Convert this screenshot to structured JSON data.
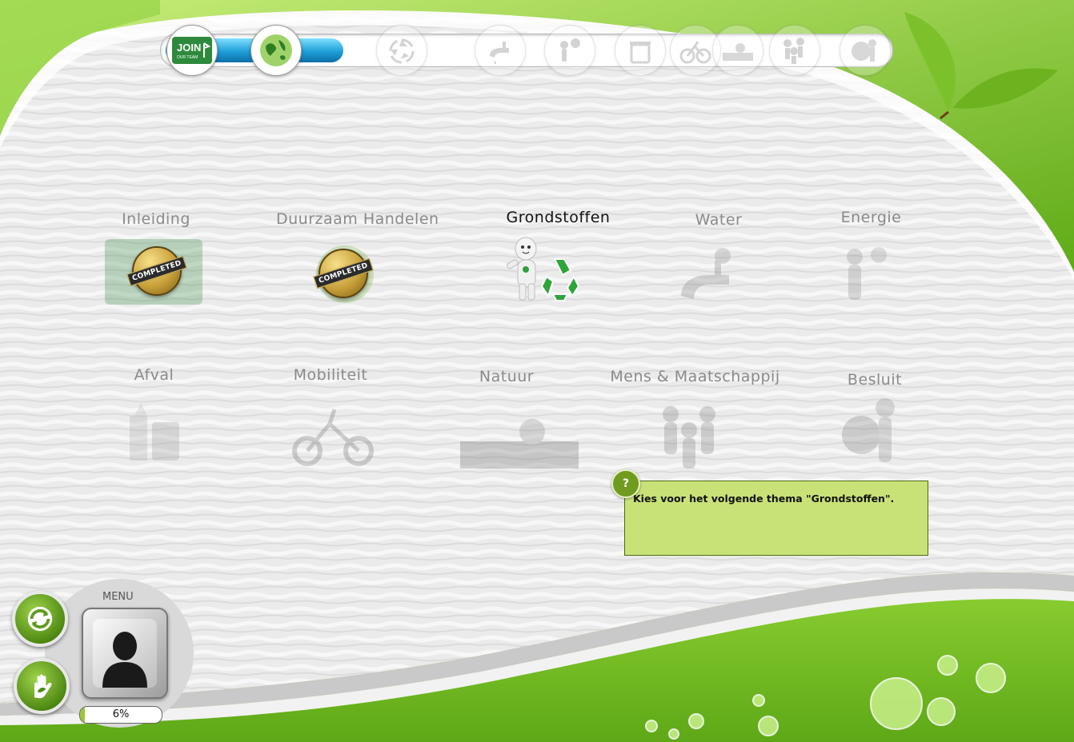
{
  "progress_nodes": [
    {
      "icon": "join-our-team-icon",
      "label_big": "JOIN",
      "label_small": "OUR TEAM",
      "state": "done"
    },
    {
      "icon": "green-globe-icon",
      "state": "done"
    },
    {
      "icon": "recycle-icon",
      "state": "locked"
    },
    {
      "icon": "water-tap-icon",
      "state": "locked"
    },
    {
      "icon": "sun-figure-icon",
      "state": "locked"
    },
    {
      "icon": "trash-bin-icon",
      "state": "locked"
    },
    {
      "icon": "bicycle-icon",
      "state": "locked"
    },
    {
      "icon": "nature-icon",
      "state": "locked"
    },
    {
      "icon": "people-group-icon",
      "state": "locked"
    },
    {
      "icon": "figure-with-globe-icon",
      "state": "locked"
    }
  ],
  "path_progress": 0.2,
  "themes": [
    {
      "label": "Inleiding",
      "state": "completed",
      "icon": "join-our-team-icon",
      "badge": "COMPLETED"
    },
    {
      "label": "Duurzaam Handelen",
      "state": "completed",
      "icon": "green-globe-icon",
      "badge": "COMPLETED"
    },
    {
      "label": "Grondstoffen",
      "state": "active",
      "icon": "recycle-figure-icon"
    },
    {
      "label": "Water",
      "state": "locked",
      "icon": "water-tap-icon"
    },
    {
      "label": "Energie",
      "state": "locked",
      "icon": "sun-figure-icon"
    },
    {
      "label": "Afval",
      "state": "locked",
      "icon": "trash-bin-icon"
    },
    {
      "label": "Mobiliteit",
      "state": "locked",
      "icon": "bicycle-icon"
    },
    {
      "label": "Natuur",
      "state": "locked",
      "icon": "nature-icon"
    },
    {
      "label": "Mens & Maatschappij",
      "state": "locked",
      "icon": "people-group-icon"
    },
    {
      "label": "Besluit",
      "state": "locked",
      "icon": "figure-with-globe-icon"
    }
  ],
  "hint": {
    "symbol": "?",
    "text": "Kies voor het volgende thema \"Grondstoffen\"."
  },
  "menu": {
    "label": "MENU",
    "icon": "user-silhouette-icon"
  },
  "buttons": {
    "refresh_icon": "refresh-icon",
    "hand_icon": "hand-leaf-icon"
  },
  "progress": {
    "label": "6%",
    "value": 0.06
  },
  "colors": {
    "accent_green": "#8cc63f",
    "hint_bg": "#c9e277",
    "progress_blue": "#1f9fd8",
    "text_active": "#111111",
    "text_inactive": "#8a8a8a"
  }
}
